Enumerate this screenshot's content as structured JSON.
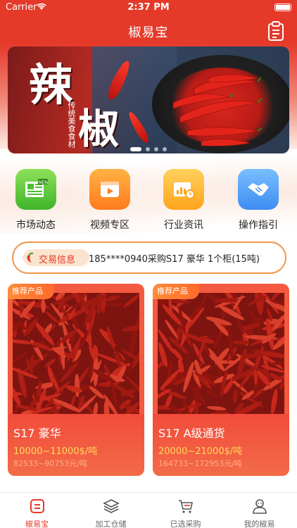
{
  "status_bar": {
    "carrier": "Carrier",
    "time": "2:37 PM"
  },
  "nav": {
    "title": "椒易宝",
    "right_icon": "clipboard-icon"
  },
  "banner": {
    "big_chars": [
      "辣",
      "椒"
    ],
    "vertical_text": "传统美食食材",
    "slides_count": 4,
    "active_slide": 1
  },
  "quick_menu": [
    {
      "label": "市场动态",
      "icon": "newspaper-icon",
      "color": "#4cc031"
    },
    {
      "label": "视频专区",
      "icon": "video-icon",
      "color": "#ff8a25"
    },
    {
      "label": "行业资讯",
      "icon": "chart-clock-icon",
      "color": "#ffb025"
    },
    {
      "label": "操作指引",
      "icon": "handshake-icon",
      "color": "#4a97f5"
    }
  ],
  "trade_info": {
    "badge": "交易信息",
    "text": "185****0940采购S17 豪华   1个柜(15吨)"
  },
  "products": [
    {
      "tag": "推荐产品",
      "name": "S17 豪华",
      "price": "10000~11000$/吨",
      "price_cny": "82533~90753元/吨"
    },
    {
      "tag": "推荐产品",
      "name": "S17 A级通货",
      "price": "20000~21000$/吨",
      "price_cny": "164733~172953元/吨"
    }
  ],
  "tabbar": [
    {
      "label": "椒易宝",
      "icon": "home-icon",
      "active": true
    },
    {
      "label": "加工仓储",
      "icon": "layers-icon",
      "active": false
    },
    {
      "label": "已选采购",
      "icon": "cart-icon",
      "active": false
    },
    {
      "label": "我的椒易",
      "icon": "user-icon",
      "active": false
    }
  ],
  "colors": {
    "brand": "#e53a2a",
    "card": "#f35a3e",
    "price": "#ffd85c",
    "trade_border": "#f0964b"
  }
}
